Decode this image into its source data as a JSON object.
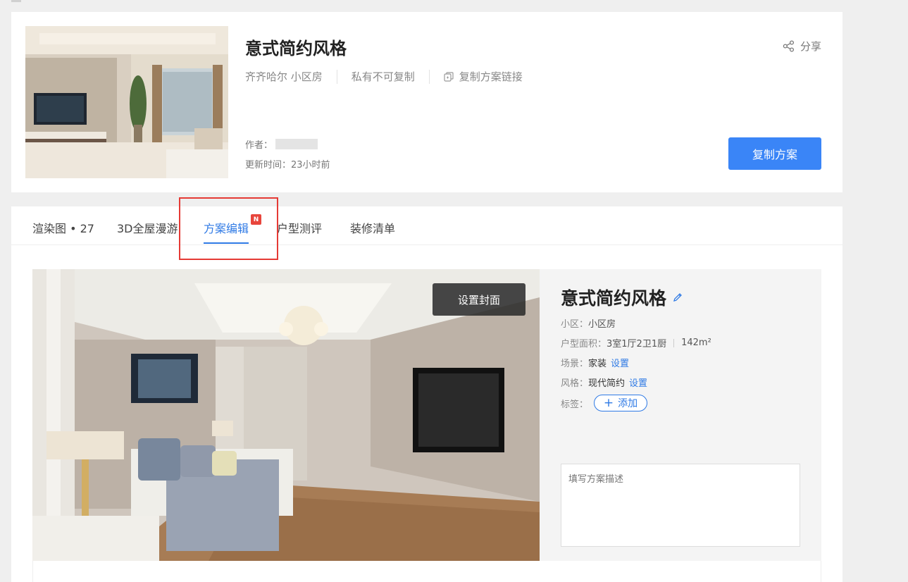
{
  "plan": {
    "title": "意式简约风格",
    "location": "齐齐哈尔 小区房",
    "privacy": "私有不可复制",
    "copy_link_label": "复制方案链接",
    "share_label": "分享",
    "author_label": "作者：",
    "update_time": "更新时间：23小时前",
    "copy_plan_button": "复制方案"
  },
  "tabs": [
    {
      "label": "渲染图 • 27"
    },
    {
      "label": "3D全屋漫游"
    },
    {
      "label": "方案编辑",
      "active": true,
      "badge": "N"
    },
    {
      "label": "户型测评"
    },
    {
      "label": "装修清单"
    }
  ],
  "render": {
    "set_cover_button": "设置封面"
  },
  "info": {
    "title": "意式简约风格",
    "community_label": "小区：",
    "community_value": "小区房",
    "layout_label": "户型面积：",
    "layout_value": "3室1厅2卫1厨",
    "area_value": "142m²",
    "scene_label": "场景：",
    "scene_value": "家装",
    "style_label": "风格：",
    "style_value": "现代简约",
    "set_link": "设置",
    "tag_label": "标签：",
    "add_tag": "添加",
    "description_placeholder": "填写方案描述"
  },
  "colors": {
    "accent": "#2f7ae5",
    "primary_button": "#3a85f7",
    "badge": "#e8453c",
    "highlight": "#e53a35"
  }
}
